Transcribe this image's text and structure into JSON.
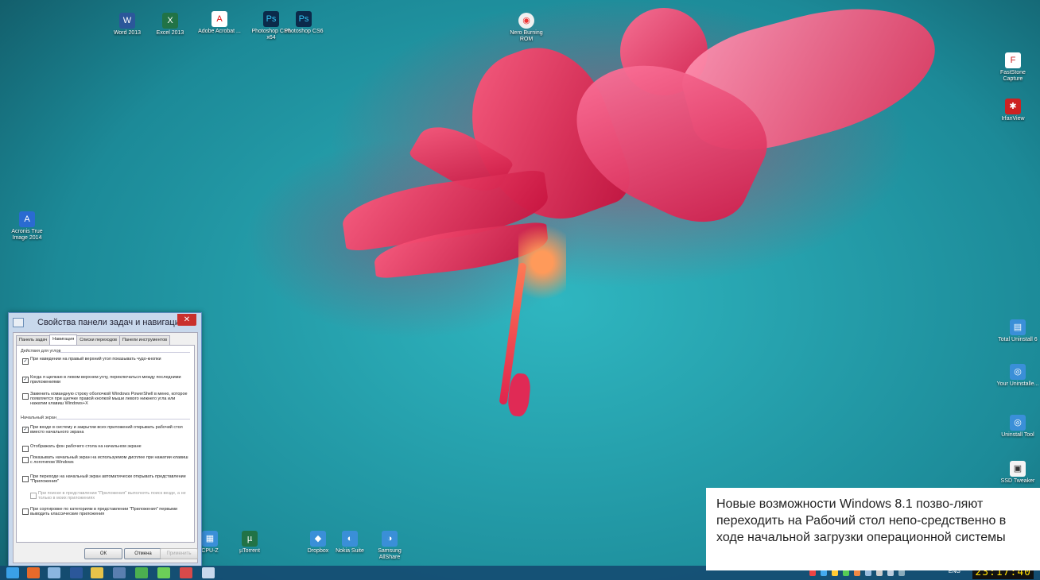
{
  "desktop_icons": [
    {
      "name": "Word 2013",
      "icon": "word-icon",
      "glyph": "W"
    },
    {
      "name": "Excel 2013",
      "icon": "excel-icon",
      "glyph": "X"
    },
    {
      "name": "Adobe Acrobat ...",
      "icon": "pdf-icon",
      "glyph": "A"
    },
    {
      "name": "Photoshop CS6 x64",
      "icon": "photoshop-icon",
      "glyph": "Ps"
    },
    {
      "name": "Photoshop CS6",
      "icon": "photoshop-icon",
      "glyph": "Ps"
    },
    {
      "name": "Nero Burning ROM",
      "icon": "nero-icon",
      "glyph": "◉"
    },
    {
      "name": "FastStone Capture",
      "icon": "faststone-icon",
      "glyph": "F"
    },
    {
      "name": "IrfanView",
      "icon": "irfanview-icon",
      "glyph": "✱"
    },
    {
      "name": "Acronis True Image 2014",
      "icon": "acronis-icon",
      "glyph": "A"
    },
    {
      "name": "Total Uninstall 6",
      "icon": "uninstall-icon",
      "glyph": "▤"
    },
    {
      "name": "Your Uninstalle...",
      "icon": "uninstaller-icon",
      "glyph": "◎"
    },
    {
      "name": "Uninstall Tool",
      "icon": "uninstall-tool-icon",
      "glyph": "◎"
    },
    {
      "name": "SSD Tweaker",
      "icon": "ssd-icon",
      "glyph": "▣"
    },
    {
      "name": "CPU-Z",
      "icon": "cpuz-icon",
      "glyph": "▦"
    },
    {
      "name": "µTorrent",
      "icon": "utorrent-icon",
      "glyph": "µ"
    },
    {
      "name": "Dropbox",
      "icon": "dropbox-icon",
      "glyph": "◆"
    },
    {
      "name": "Nokia Suite",
      "icon": "nokia-icon",
      "glyph": "◐"
    },
    {
      "name": "Samsung AllShare",
      "icon": "allshare-icon",
      "glyph": "◑"
    }
  ],
  "dialog": {
    "title": "Свойства панели задач и навигации",
    "close_label": "✕",
    "tabs": [
      "Панель задач",
      "Навигация",
      "Списки переходов",
      "Панели инструментов"
    ],
    "active_tab": "Навигация",
    "group_corners": {
      "title": "Действия для углов",
      "options": [
        {
          "label": "При наведении на правый верхний угол показывать чудо-кнопки",
          "checked": true,
          "enabled": true
        },
        {
          "label": "Когда я щелкаю в левом верхнем углу, переключаться между последними приложениями",
          "checked": true,
          "enabled": true
        },
        {
          "label": "Заменить командную строку оболочкой Windows PowerShell в меню, которое появляется при щелчке правой кнопкой мыши левого нижнего угла или нажатии клавиш Windows+X",
          "checked": false,
          "enabled": true
        }
      ]
    },
    "group_start": {
      "title": "Начальный экран",
      "options": [
        {
          "label": "При входе в систему и закрытии всех приложений открывать рабочий стол вместо начального экрана",
          "checked": true,
          "enabled": true
        },
        {
          "label": "Отображать фон рабочего стола на начальном экране",
          "checked": false,
          "enabled": true
        },
        {
          "label": "Показывать начальный экран на используемом дисплее при нажатии клавиш с логотипом Windows",
          "checked": false,
          "enabled": true
        },
        {
          "label": "При переходе на начальный экран автоматически открывать представление \"Приложения\"",
          "checked": false,
          "enabled": true
        },
        {
          "label": "При поиске в представлении \"Приложения\" выполнять поиск везде, а не только в моих приложениях",
          "checked": false,
          "enabled": false
        },
        {
          "label": "При сортировке по категориям в представлении \"Приложения\" первыми выводить классические приложения",
          "checked": false,
          "enabled": true
        }
      ]
    },
    "buttons": {
      "ok": "ОК",
      "cancel": "Отмена",
      "apply": "Применить"
    }
  },
  "taskbar": {
    "clock": "23:17:40",
    "lang": "ENG"
  },
  "caption": {
    "text": "Новые возможности Windows 8.1 позво-ляют переходить на Рабочий стол непо-средственно в ходе начальной загрузки операционной системы"
  },
  "colors": {
    "desktop_teal": "#2fb6c0",
    "flower_red": "#d01a48",
    "dialog_frame": "#c8d8ec",
    "close_red": "#c9302c",
    "clock_yellow": "#ffdc00"
  }
}
